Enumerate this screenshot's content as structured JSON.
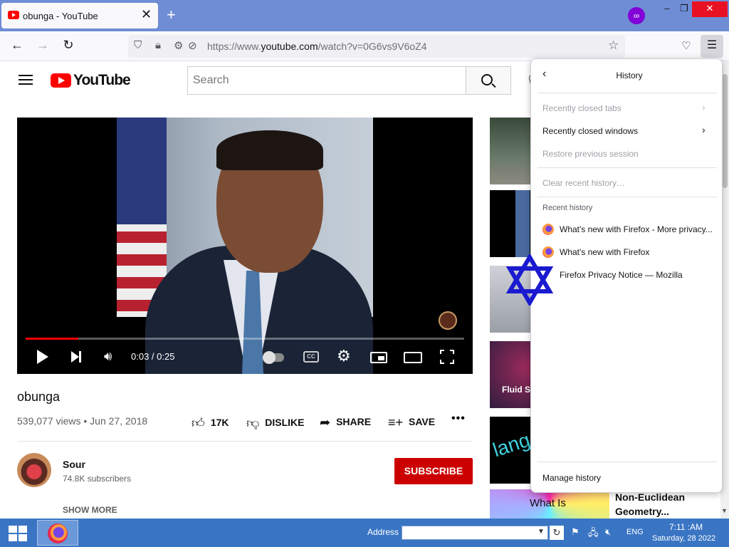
{
  "browser": {
    "tab_title": "obunga - YouTube",
    "tab_close": "✕",
    "new_tab": "+",
    "url_prefix": "https://www.",
    "url_domain": "youtube.com",
    "url_path": "/watch?v=0G6vs9V6oZ4",
    "window_controls": {
      "minimize": "–",
      "restore": "❐",
      "close": "✕"
    }
  },
  "youtube": {
    "logo_text": "YouTube",
    "search_placeholder": "Search",
    "video": {
      "time": "0:03 / 0:25",
      "progress_fraction": 0.12,
      "cc_label": "CC"
    },
    "title": "obunga",
    "meta": "539,077 views • Jun 27, 2018",
    "actions": {
      "like": "17K",
      "dislike": "DISLIKE",
      "share": "SHARE",
      "save": "SAVE",
      "more": "•••"
    },
    "channel": {
      "name": "Sour",
      "subscribers": "74.8K subscribers",
      "subscribe_label": "SUBSCRIBE"
    },
    "show_more": "SHOW MORE",
    "sidebar": {
      "thumb_4_label": "Fluid Si",
      "thumb_5_label": "lang",
      "thumb_6_label": "What Is",
      "related_title": "Non-Euclidean Geometry..."
    }
  },
  "history_panel": {
    "title": "History",
    "recently_closed_tabs": "Recently closed tabs",
    "recently_closed_windows": "Recently closed windows",
    "restore_previous_session": "Restore previous session",
    "clear_recent_history": "Clear recent history…",
    "recent_history_header": "Recent history",
    "items": [
      "What's new with Firefox - More privacy...",
      "What's new with Firefox",
      "Firefox Privacy Notice — Mozilla"
    ],
    "manage_history": "Manage history"
  },
  "taskbar": {
    "address_label": "Address",
    "language": "ENG",
    "time": "7:11 :AM",
    "date": "Saturday, 28 2022"
  },
  "colors": {
    "tabbar": "#6e8dd5",
    "youtube_red": "#ff0000",
    "subscribe_red": "#cc0000",
    "taskbar": "#3a75c4",
    "star_overlay": "#1a1ad0"
  }
}
